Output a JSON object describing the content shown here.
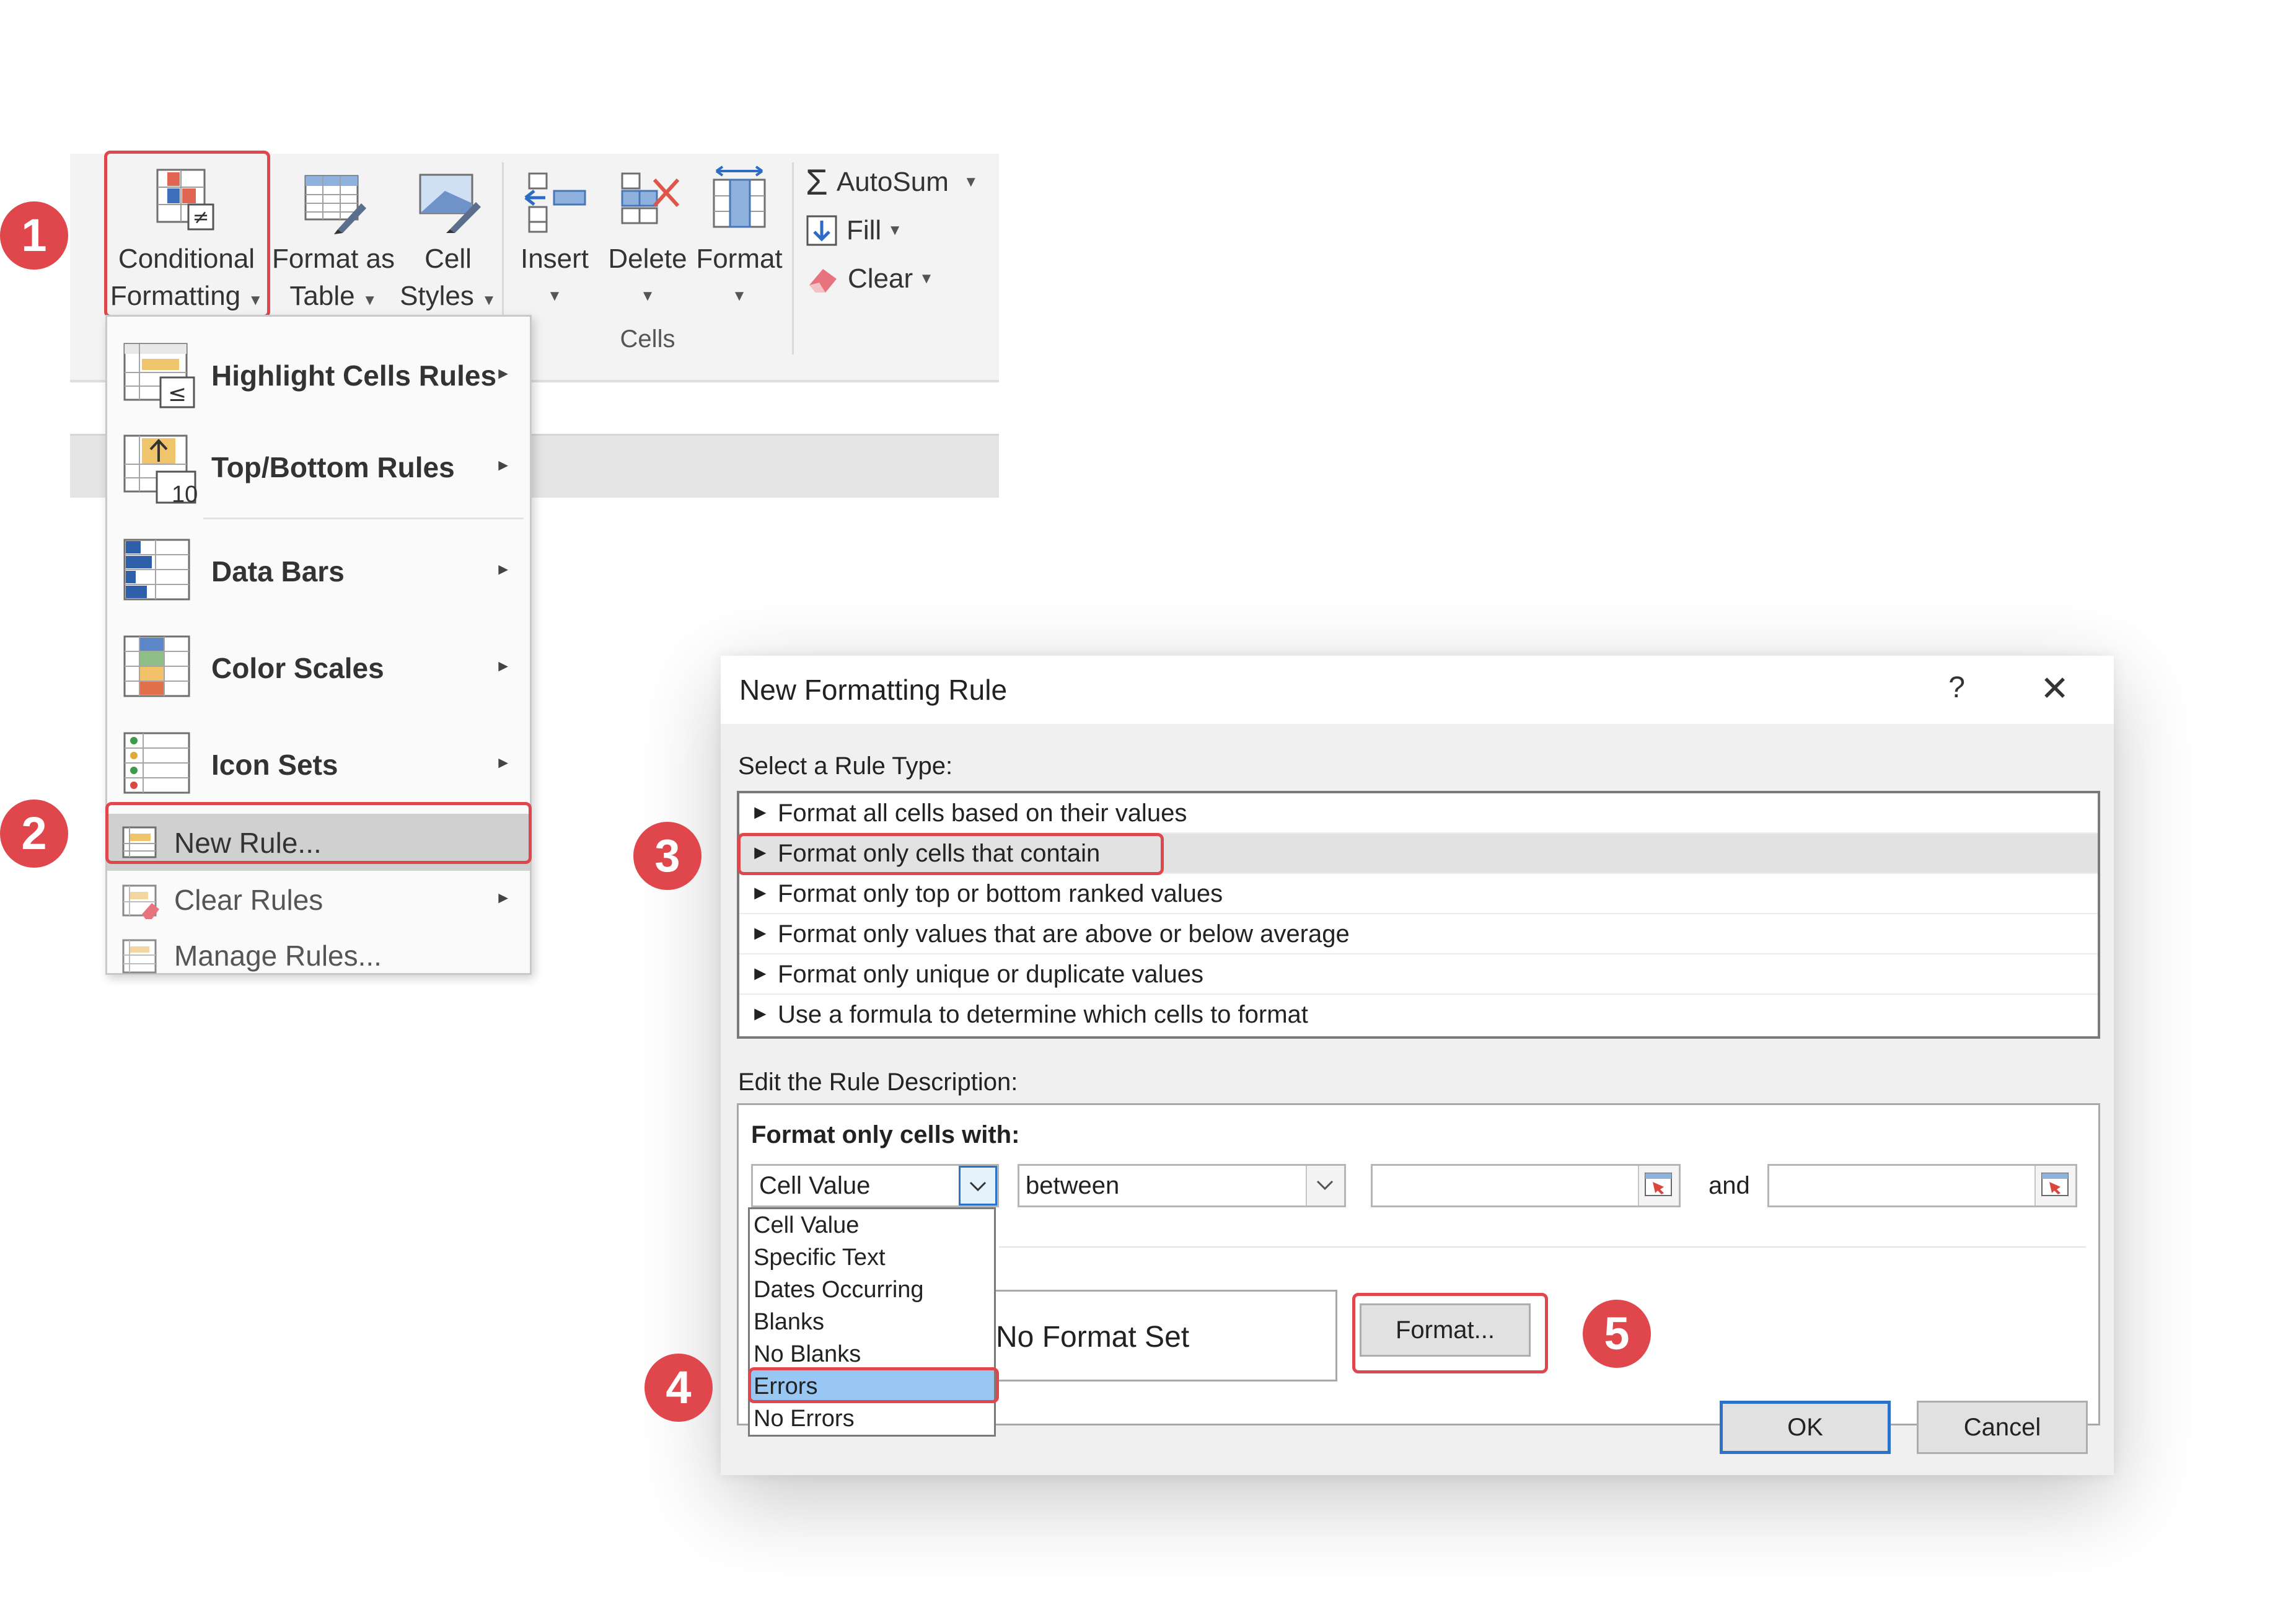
{
  "ribbon": {
    "styles": {
      "conditional_formatting": [
        "Conditional",
        "Formatting"
      ],
      "format_as_table": [
        "Format as",
        "Table"
      ],
      "cell_styles": [
        "Cell",
        "Styles"
      ]
    },
    "cells": {
      "insert": "Insert",
      "delete": "Delete",
      "format": "Format",
      "group_label": "Cells"
    },
    "editing": {
      "autosum": "AutoSum",
      "fill": "Fill",
      "clear": "Clear"
    }
  },
  "menu": {
    "items": [
      {
        "label": "Highlight Cells Rules",
        "submenu": true
      },
      {
        "label": "Top/Bottom Rules",
        "submenu": true
      },
      {
        "label": "Data Bars",
        "submenu": true
      },
      {
        "label": "Color Scales",
        "submenu": true
      },
      {
        "label": "Icon Sets",
        "submenu": true
      }
    ],
    "small_items": [
      {
        "label": "New Rule..."
      },
      {
        "label": "Clear Rules",
        "submenu": true
      },
      {
        "label": "Manage Rules..."
      }
    ],
    "top10": "10"
  },
  "steps": [
    "1",
    "2",
    "3",
    "4",
    "5"
  ],
  "dialog": {
    "title": "New Formatting Rule",
    "help": "?",
    "close": "✕",
    "select_rule_type_label": "Select a Rule Type:",
    "rule_types": [
      "Format all cells based on their values",
      "Format only cells that contain",
      "Format only top or bottom ranked values",
      "Format only values that are above or below average",
      "Format only unique or duplicate values",
      "Use a formula to determine which cells to format"
    ],
    "selected_rule_index": 1,
    "edit_description_label": "Edit the Rule Description:",
    "format_only_cells_with": "Format only cells with:",
    "condition_combo": "Cell Value",
    "operator_combo": "between",
    "and_label": "and",
    "condition_options": [
      "Cell Value",
      "Specific Text",
      "Dates Occurring",
      "Blanks",
      "No Blanks",
      "Errors",
      "No Errors"
    ],
    "highlighted_option": "Errors",
    "preview_text": "No Format Set",
    "format_button": "Format...",
    "ok_button": "OK",
    "cancel_button": "Cancel"
  },
  "colors": {
    "accent_red": "#e0474c",
    "selection_blue": "#99c7f3",
    "default_button_border": "#2a73c8"
  }
}
